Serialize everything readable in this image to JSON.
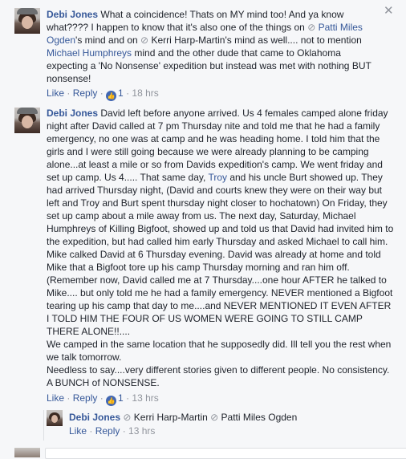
{
  "icons": {
    "close": "✕",
    "like_thumb": "thumbs-up-icon",
    "tag": "tag-icon"
  },
  "comments": [
    {
      "author": "Debi Jones",
      "text_a": " What a coincidence! Thats on MY mind too! And ya know what???? I happen to know that it's also one of the things on ",
      "mention_1": "Patti Miles Ogden",
      "text_b": "'s mind and on ",
      "mention_2": "Kerri Harp-Martin",
      "text_c": "'s mind as well.... not to mention ",
      "mention_3": "Michael Humphreys",
      "text_d": " mind and the other dude that came to Oklahoma expecting a 'No Nonsense' expedition but instead was met with nothing BUT nonsense!",
      "like": "Like",
      "reply": "Reply",
      "like_count": "1",
      "time": "18 hrs"
    },
    {
      "author": "Debi Jones",
      "text_a": " David left before anyone arrived. Us 4 females camped alone friday night after David called at 7 pm Thursday nite and told me that he had a family emergency, no one was at camp and he was heading home. I told him that the girls and I were still going because we were already planning to be camping alone...at least a mile or so from Davids expedition's camp. We went friday and set up camp. Us 4..... That same day, ",
      "mention_1": "Troy",
      "text_b": " and his uncle Burt showed up. They had arrived Thursday night, (David and courts knew they were on their way but left and Troy and Burt spent thursday night closer to hochatown) On Friday, they set up camp about a mile away from us. The next day, Saturday, Michael Humphreys of Killing Bigfoot, showed up and told us that David had invited him to the expedition, but had called him early Thursday and asked Michael to call him. Mike calked David at 6 Thursday evening. David was already at home and told Mike that a Bigfoot tore up his camp Thursday morning and ran him off. (Remember now, David called me at 7 Thursday....one hour AFTER he talked to Mike.... but only told me he had a family emergency. NEVER mentioned a Bigfoot tearing up his camp that day to me....and NEVER MENTIONED IT EVEN AFTER I TOLD HIM THE FOUR OF US WOMEN WERE GOING TO STILL CAMP THERE ALONE!!....",
      "text_c": "We camped in the same location that he supposedly did. Ill tell you the rest when we talk tomorrow.",
      "text_d": "Needless to say....very different stories given to different people. No consistency. A BUNCH of NONSENSE.",
      "like": "Like",
      "reply": "Reply",
      "like_count": "1",
      "time": "13 hrs"
    },
    {
      "author": "Debi Jones",
      "mention_1": "Kerri Harp-Martin",
      "mention_2": "Patti Miles Ogden",
      "like": "Like",
      "reply": "Reply",
      "time": "13 hrs"
    }
  ]
}
